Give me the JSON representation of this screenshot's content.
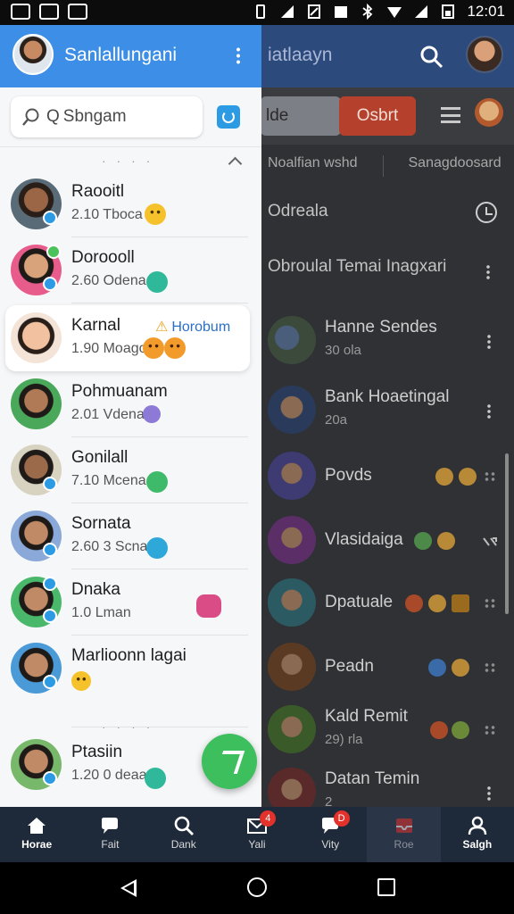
{
  "status_bar": {
    "time": "12:01"
  },
  "background_app": {
    "title": "iatlaayn",
    "field_text": "lde",
    "button_label": "Osbrt",
    "tabs": [
      "Noalfian wshd",
      "Sanagdoosard"
    ],
    "section_1": "Odreala",
    "section_2": "Obroulal Temai Inagxari",
    "rows": [
      {
        "name": "Hanne Sendes",
        "sub": "30 ola"
      },
      {
        "name": "Bank Hoaetingal",
        "sub": "20a"
      },
      {
        "name": "Povds",
        "sub": ""
      },
      {
        "name": "Vlasidaiga",
        "sub": ""
      },
      {
        "name": "Dpatuale",
        "sub": ""
      },
      {
        "name": "Peadn",
        "sub": ""
      },
      {
        "name": "Kald Remit",
        "sub": "29) rla"
      },
      {
        "name": "Datan Temin",
        "sub": "2"
      }
    ]
  },
  "drawer": {
    "header_name": "Sanlallungani",
    "search_placeholder": "Sbngam",
    "search_q": "Q",
    "contacts": [
      {
        "name": "Raooitl",
        "sub": "2.10 Tboca"
      },
      {
        "name": "Doroooll",
        "sub": "2.60 Odena"
      },
      {
        "name": "Karnal",
        "sub": "1.90 Moago",
        "tag": "Horobum"
      },
      {
        "name": "Pohmuanam",
        "sub": "2.01 Vdena"
      },
      {
        "name": "Gonilall",
        "sub": "7.10 Mcena"
      },
      {
        "name": "Sornata",
        "sub": "2.60 3 Scna"
      },
      {
        "name": "Dnaka",
        "sub": "1.0 Lman"
      },
      {
        "name": "Marlioonn lagai",
        "sub": ""
      },
      {
        "name": "Ptasiin",
        "sub": "1.20 0 deaa"
      }
    ]
  },
  "bottom_nav": {
    "items": [
      {
        "label": "Horae"
      },
      {
        "label": "Fait"
      },
      {
        "label": "Dank"
      },
      {
        "label": "Yali",
        "badge": "4"
      },
      {
        "label": "Vity",
        "badge": "D"
      },
      {
        "label": "Roe"
      },
      {
        "label": "Salgh"
      }
    ]
  },
  "colors": {
    "accent": "#3d8ee6",
    "fab": "#3cbf5c",
    "nav_bg": "#1e2a3a",
    "badge": "#e3322b"
  }
}
